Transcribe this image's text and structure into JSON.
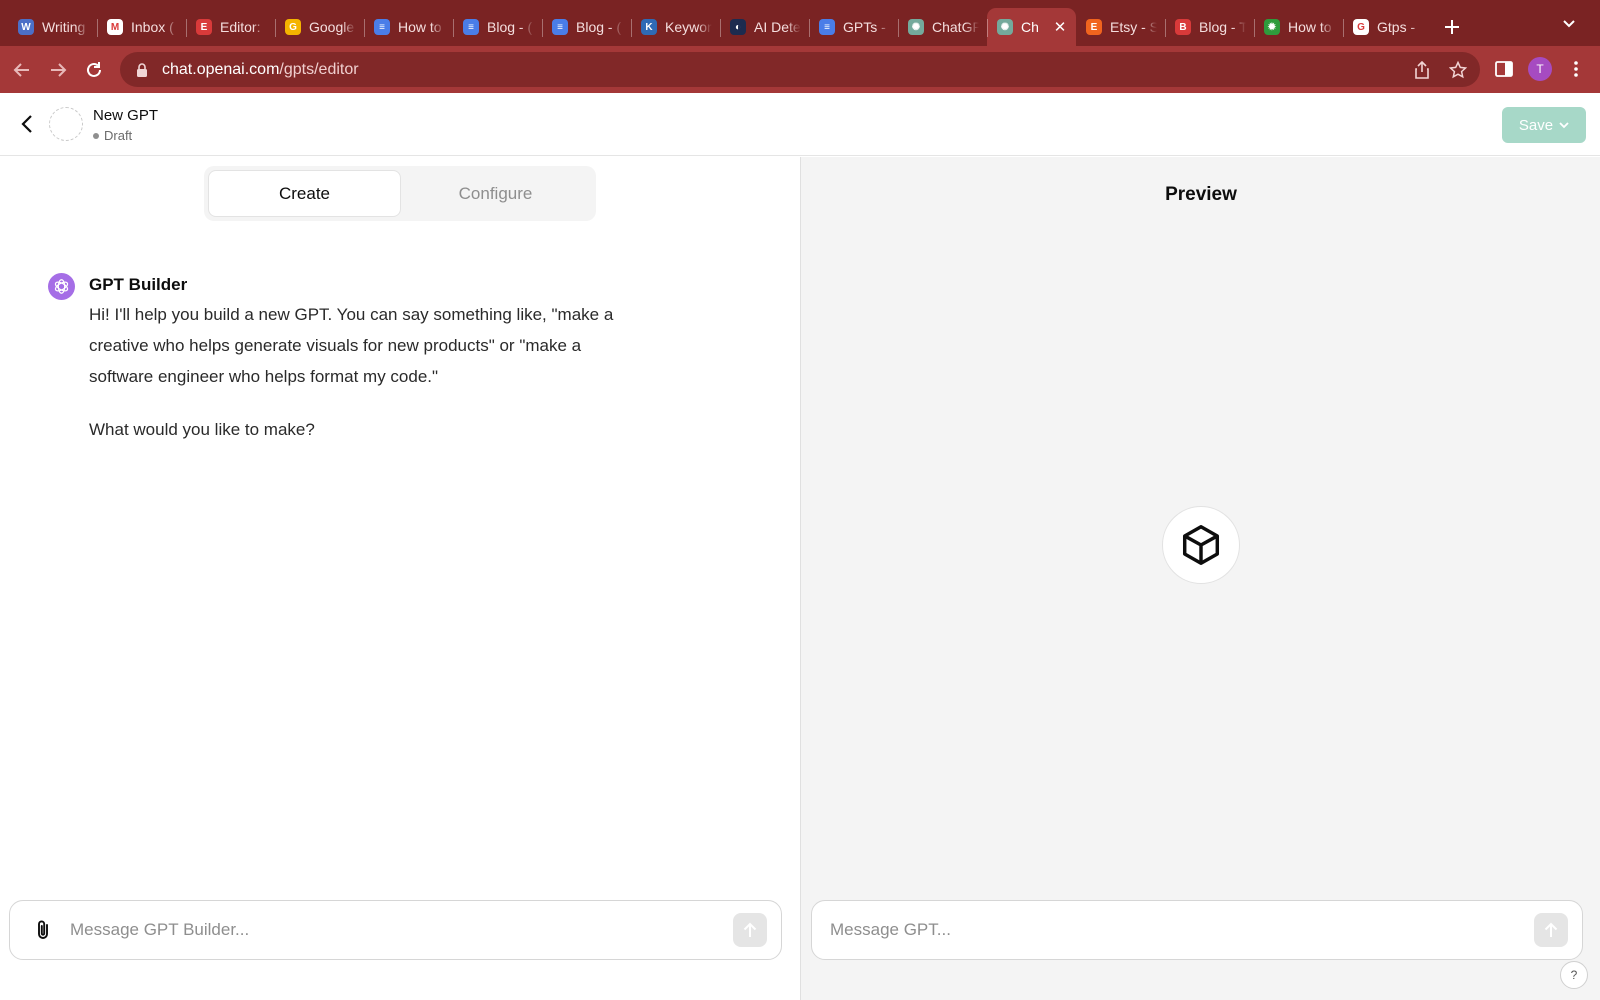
{
  "browser": {
    "tabs": [
      {
        "title": "Writing",
        "favicon": "writing-favicon",
        "color": "#4c6fc7",
        "letter": "W"
      },
      {
        "title": "Inbox (",
        "favicon": "gmail-favicon",
        "color": "#ffffff",
        "letter": "M"
      },
      {
        "title": "Editor: ",
        "favicon": "editor-favicon",
        "color": "#d93a3a",
        "letter": "E"
      },
      {
        "title": "Google",
        "favicon": "google-drive-favicon",
        "color": "#f5b400",
        "letter": "G"
      },
      {
        "title": "How to",
        "favicon": "docs-favicon",
        "color": "#4a7de8",
        "letter": "≡"
      },
      {
        "title": "Blog - (",
        "favicon": "docs-favicon",
        "color": "#4a7de8",
        "letter": "≡"
      },
      {
        "title": "Blog - (",
        "favicon": "docs-favicon",
        "color": "#4a7de8",
        "letter": "≡"
      },
      {
        "title": "Keywor",
        "favicon": "keyword-favicon",
        "color": "#2f6ab5",
        "letter": "K"
      },
      {
        "title": "AI Dete",
        "favicon": "ai-detector-favicon",
        "color": "#1d2b4f",
        "letter": "◐"
      },
      {
        "title": "GPTs - ",
        "favicon": "docs-favicon",
        "color": "#4a7de8",
        "letter": "≡"
      },
      {
        "title": "ChatGP",
        "favicon": "chatgpt-favicon",
        "color": "#74aa9c",
        "letter": "✺"
      },
      {
        "title": "Ch",
        "favicon": "chatgpt-favicon",
        "color": "#74aa9c",
        "letter": "✺",
        "active": true
      },
      {
        "title": "Etsy - S",
        "favicon": "etsy-favicon",
        "color": "#f1641e",
        "letter": "E"
      },
      {
        "title": "Blog - T",
        "favicon": "editor-favicon",
        "color": "#d93a3a",
        "letter": "B"
      },
      {
        "title": "How to",
        "favicon": "burst-favicon",
        "color": "#2e9b3c",
        "letter": "✹"
      },
      {
        "title": "Gtps - ",
        "favicon": "google-favicon",
        "color": "#ffffff",
        "letter": "G"
      }
    ],
    "url_host": "chat.openai.com",
    "url_path": "/gpts/editor",
    "profile_initial": "T",
    "accent_color": "#a43838"
  },
  "header": {
    "name": "New GPT",
    "status": "Draft",
    "save_label": "Save"
  },
  "builder": {
    "tabs": [
      "Create",
      "Configure"
    ],
    "active_tab": "Create",
    "sender": "GPT Builder",
    "message_paragraphs": [
      "Hi! I'll help you build a new GPT. You can say something like, \"make a creative who helps generate visuals for new products\" or \"make a software engineer who helps format my code.\"",
      "What would you like to make?"
    ],
    "input_placeholder": "Message GPT Builder..."
  },
  "preview": {
    "title": "Preview",
    "input_placeholder": "Message GPT...",
    "help_label": "?"
  }
}
